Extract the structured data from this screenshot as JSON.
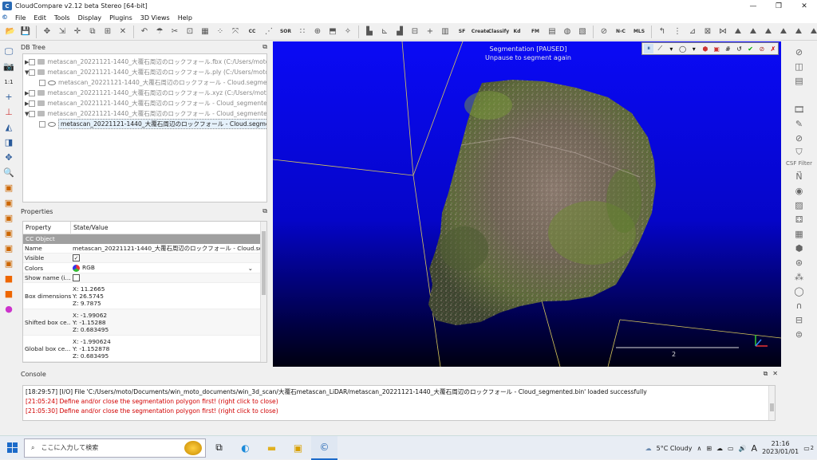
{
  "window": {
    "title": "CloudCompare v2.12 beta Stereo [64-bit]",
    "controls": [
      "—",
      "❐",
      "✕"
    ]
  },
  "menu": [
    "File",
    "Edit",
    "Tools",
    "Display",
    "Plugins",
    "3D Views",
    "Help"
  ],
  "toolbar": {
    "sor_label": "SOR",
    "sf_label": "SF",
    "kd_label": "Kd",
    "fm_label": "FM",
    "nc_label": "N‹C",
    "mls_label": "MLS",
    "clean_label": "Create",
    "classify_label": "Classify"
  },
  "db_tree": {
    "title": "DB Tree",
    "items": [
      {
        "label": "metascan_20221121-1440_大覆石周辺のロックフォール.fbx (C:/Users/moto/...",
        "arrow": "▶"
      },
      {
        "label": "metascan_20221121-1440_大覆石周辺のロックフォール.ply (C:/Users/moto/...",
        "arrow": "▼"
      },
      {
        "label": "metascan_20221121-1440_大覆石周辺のロックフォール - Cloud.segmented",
        "arrow": ""
      },
      {
        "label": "metascan_20221121-1440_大覆石周辺のロックフォール.xyz (C:/Users/moto/...",
        "arrow": "▶"
      },
      {
        "label": "metascan_20221121-1440_大覆石周辺のロックフォール - Cloud_segmented.t...",
        "arrow": "▶"
      },
      {
        "label": "metascan_20221121-1440_大覆石周辺のロックフォール - Cloud_segmented....",
        "arrow": "▼"
      },
      {
        "label": "metascan_20221121-1440_大覆石周辺のロックフォール - Cloud.segmented",
        "arrow": ""
      }
    ]
  },
  "properties": {
    "title": "Properties",
    "col_property": "Property",
    "col_value": "State/Value",
    "section": "CC Object",
    "name_key": "Name",
    "name_value": "metascan_20221121-1440_大覆石周辺のロックフォール - Cloud.seg...",
    "visible_key": "Visible",
    "colors_key": "Colors",
    "colors_value": "RGB",
    "showname_key": "Show name (i...",
    "box_dim_key": "Box dimensions",
    "box_dim": [
      "X: 11.2665",
      "Y: 26.5745",
      "Z: 9.7875"
    ],
    "shifted_key": "Shifted box ce...",
    "shifted": [
      "X: -1.99062",
      "Y: -1.15288",
      "Z: 0.683495"
    ],
    "global_key": "Global box ce...",
    "global": [
      "X: -1.990624",
      "Y: -1.152878",
      "Z: 0.683495"
    ]
  },
  "viewport": {
    "status": "Segmentation [PAUSED]",
    "hint": "Unpause to segment again",
    "scale_value": "2"
  },
  "righttools": {
    "csf_label": "CSF Filter"
  },
  "console": {
    "title": "Console",
    "lines": [
      {
        "type": "info",
        "text": "[18:29:57] [I/O] File 'C:/Users/moto/Documents/win_moto_documents/win_3d_scan/大覆石metascan_LiDAR/metascan_20221121-1440_大覆石周辺のロックフォール - Cloud_segmented.bin' loaded successfully"
      },
      {
        "type": "err",
        "text": "[21:05:24] Define and/or close the segmentation polygon first! (right click to close)"
      },
      {
        "type": "err",
        "text": "[21:05:30] Define and/or close the segmentation polygon first! (right click to close)"
      }
    ]
  },
  "taskbar": {
    "search_placeholder": "ここに入力して検索",
    "weather": "5°C  Cloudy",
    "ime": "A",
    "time": "21:16",
    "date": "2023/01/01",
    "notifications": "2"
  },
  "colors": {
    "viewport_top": "#0a0af5",
    "console_error": "#d10000",
    "accent": "#1b6ac9"
  }
}
